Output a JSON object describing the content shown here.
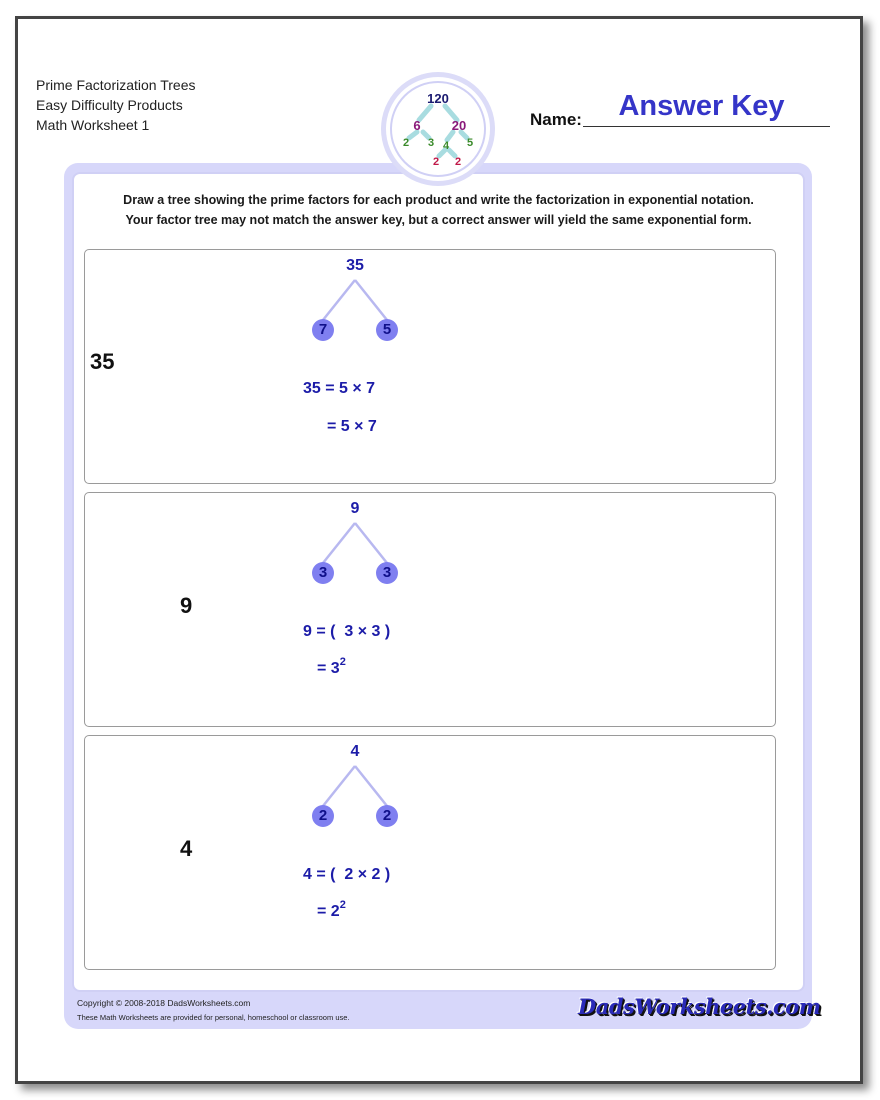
{
  "header": {
    "lines": [
      "Prime Factorization Trees",
      "Easy Difficulty Products",
      "Math Worksheet 1"
    ],
    "name_label": "Name:",
    "name_value": "Answer Key",
    "logo": {
      "icon": "factor-tree-icon",
      "root": "120",
      "level1": [
        "6",
        "20"
      ],
      "level2": [
        "2",
        "3",
        "4",
        "5"
      ],
      "level3": [
        "2",
        "2"
      ]
    }
  },
  "instructions": [
    "Draw a tree showing the prime factors for each product and write the factorization in exponential notation.",
    "Your factor tree may not match the answer key, but a correct answer will yield the same exponential form."
  ],
  "problems": [
    {
      "number": "35",
      "tree_root": "35",
      "leaves": [
        "7",
        "5"
      ],
      "eq1": "35 = 5 × 7",
      "eq2_base": "= 5 × 7",
      "eq2_exp": ""
    },
    {
      "number": "9",
      "tree_root": "9",
      "leaves": [
        "3",
        "3"
      ],
      "eq1": "9 = (  3 × 3 )",
      "eq2_base": "= 3",
      "eq2_exp": "2"
    },
    {
      "number": "4",
      "tree_root": "4",
      "leaves": [
        "2",
        "2"
      ],
      "eq1": "4 = (  2 × 2 )",
      "eq2_base": "= 2",
      "eq2_exp": "2"
    }
  ],
  "footer": {
    "copyright": "Copyright © 2008-2018 DadsWorksheets.com",
    "notice": "These Math Worksheets are provided for personal, homeschool or classroom use.",
    "brand": "DadsWorksheets.com"
  },
  "colors": {
    "accent": "#3535c8",
    "frame": "#d7d7fa",
    "leaf": "#7f7ff0",
    "tree_text": "#1c1ca8"
  }
}
